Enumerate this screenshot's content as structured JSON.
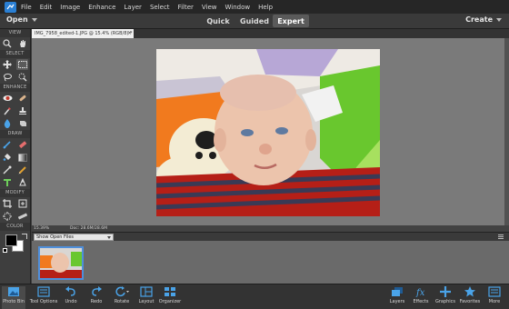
{
  "menubar": {
    "items": [
      "File",
      "Edit",
      "Image",
      "Enhance",
      "Layer",
      "Select",
      "Filter",
      "View",
      "Window",
      "Help"
    ]
  },
  "modebar": {
    "open_label": "Open",
    "tabs": [
      "Quick",
      "Guided",
      "Expert"
    ],
    "active_tab": "Expert",
    "create_label": "Create"
  },
  "toolbox": {
    "sections": [
      "VIEW",
      "SELECT",
      "ENHANCE",
      "DRAW",
      "MODIFY",
      "COLOR"
    ],
    "foreground_color": "#000000",
    "background_color": "#ffffff"
  },
  "document": {
    "tab_label": "IMG_7958_edited-1.JPG @ 15.4% (RGB/8) *",
    "close_glyph": "×"
  },
  "statusbar": {
    "zoom": "15.39%",
    "doc_size": "Doc: 28.6M/28.6M"
  },
  "photobin": {
    "show_select": "Show Open Files"
  },
  "taskbar": {
    "left": [
      "Photo Bin",
      "Tool Options",
      "Undo",
      "Redo",
      "Rotate",
      "Layout",
      "Organizer"
    ],
    "right": [
      "Layers",
      "Effects",
      "Graphics",
      "Favorites",
      "More"
    ]
  },
  "colors": {
    "accent": "#2a7fd3",
    "menubar_bg": "#262626",
    "canvas_bg": "#7a7a7a"
  }
}
